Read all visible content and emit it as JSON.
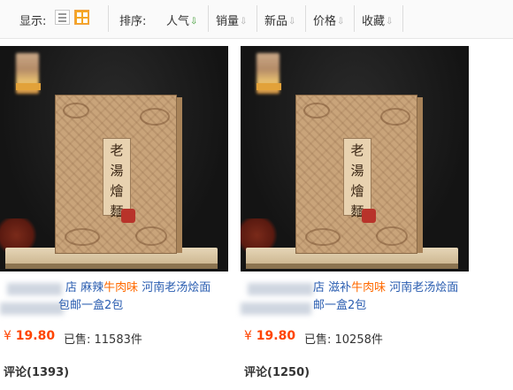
{
  "toolbar": {
    "display_label": "显示:",
    "sort_label": "排序:",
    "sort_items": [
      {
        "label": "人气",
        "active": true
      },
      {
        "label": "销量",
        "active": false
      },
      {
        "label": "新品",
        "active": false
      },
      {
        "label": "价格",
        "active": false
      },
      {
        "label": "收藏",
        "active": false
      }
    ],
    "arrow_glyph": "⇩"
  },
  "products": [
    {
      "box_text": [
        "老",
        "湯",
        "燴",
        "麵"
      ],
      "title_line1_pre": "店 麻辣",
      "title_line1_highlight": "牛肉味",
      "title_line1_post": " 河南老汤烩面",
      "title_line2": "包邮一盒2包",
      "price_currency": "¥",
      "price": "19.80",
      "sold": "已售: 11583件",
      "reviews": "评论(1393)"
    },
    {
      "box_text": [
        "老",
        "湯",
        "燴",
        "麵"
      ],
      "title_line1_pre": "店 滋补",
      "title_line1_highlight": "牛肉味",
      "title_line1_post": " 河南老汤烩面",
      "title_line2": "邮一盒2包",
      "price_currency": "¥",
      "price": "19.80",
      "sold": "已售: 10258件",
      "reviews": "评论(1250)"
    }
  ],
  "colors": {
    "link": "#2a5db0",
    "highlight": "#ff6a00",
    "price": "#ff4400",
    "active_sort_arrow": "#3a9a2f"
  }
}
